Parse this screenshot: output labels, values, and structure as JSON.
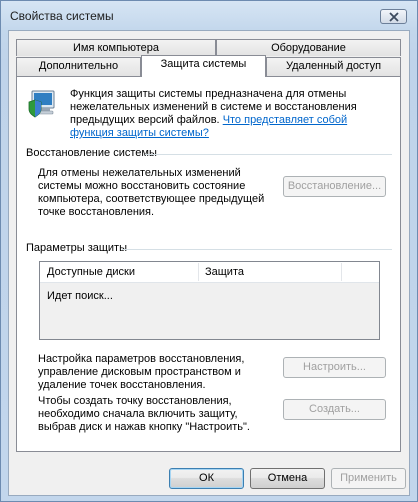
{
  "window": {
    "title": "Свойства системы"
  },
  "tabs": {
    "row1": [
      "Имя компьютера",
      "Оборудование"
    ],
    "row2": [
      "Дополнительно",
      "Защита системы",
      "Удаленный доступ"
    ]
  },
  "intro": {
    "text": "Функция защиты системы предназначена для отмены нежелательных изменений в системе и восстановления предыдущих версий файлов.",
    "link": "Что представляет собой функция защиты системы?"
  },
  "restore": {
    "group_title": "Восстановление системы",
    "text": "Для отмены нежелательных изменений системы можно восстановить состояние компьютера, соответствующее предыдущей точке восстановления.",
    "button": "Восстановление..."
  },
  "protection": {
    "group_title": "Параметры защиты",
    "columns": [
      "Доступные диски",
      "Защита"
    ],
    "searching": "Идет поиск...",
    "configure_text": "Настройка параметров восстановления, управление дисковым пространством и удаление точек восстановления.",
    "configure_button": "Настроить...",
    "create_text": "Чтобы создать точку восстановления, необходимо сначала включить защиту, выбрав диск и нажав кнопку \"Настроить\".",
    "create_button": "Создать..."
  },
  "footer": {
    "ok": "ОК",
    "cancel": "Отмена",
    "apply": "Применить"
  },
  "icons": {
    "titlebar_close": "close-icon",
    "system_protection": "shield-computer-icon"
  }
}
